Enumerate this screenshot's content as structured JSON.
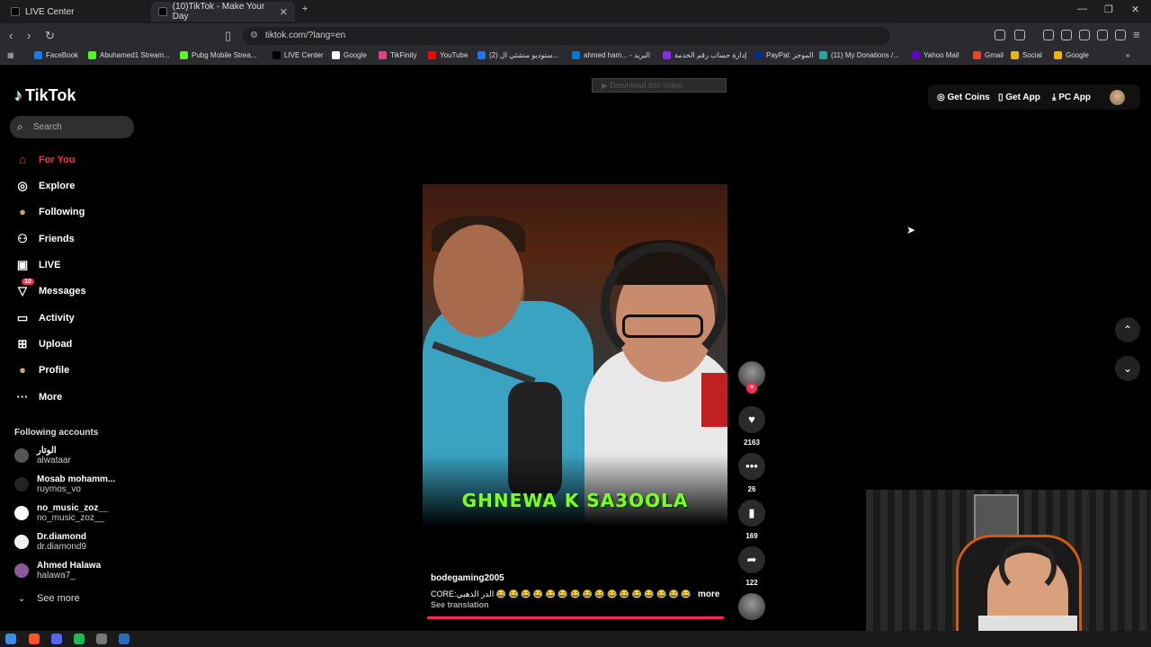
{
  "browser": {
    "tabs": [
      {
        "title": "LIVE Center"
      },
      {
        "title": "(10)TikTok - Make Your Day"
      }
    ],
    "url": "tiktok.com/?lang=en",
    "bookmarks": [
      {
        "label": "FaceBook",
        "color": "#1877f2"
      },
      {
        "label": "Abuhamed1 Stream...",
        "color": "#53fc18"
      },
      {
        "label": "Pubg Mobile Strea...",
        "color": "#53fc18"
      },
      {
        "label": "LIVE Center",
        "color": "#000000"
      },
      {
        "label": "Google",
        "color": "#ffffff"
      },
      {
        "label": "TikFinity",
        "color": "#e83e8c"
      },
      {
        "label": "YouTube",
        "color": "#ff0000"
      },
      {
        "label": "(2) ستوديو منشئي ال...",
        "color": "#1877f2"
      },
      {
        "label": "ahmed ham... - البريد",
        "color": "#0078d4"
      },
      {
        "label": "إدارة حساب رقم الخدمة",
        "color": "#8a2be2"
      },
      {
        "label": "PayPal: الموجز",
        "color": "#003087"
      },
      {
        "label": "(11) My Donations /...",
        "color": "#26a69a"
      },
      {
        "label": "Yahoo Mail",
        "color": "#6001d2"
      },
      {
        "label": "Gmail",
        "color": "#ea4335"
      },
      {
        "label": "Social",
        "color": "#e6b800"
      },
      {
        "label": "Google",
        "color": "#e6b800"
      }
    ]
  },
  "tiktok": {
    "logo": "TikTok",
    "search_placeholder": "Search",
    "nav": [
      {
        "label": "For You",
        "icon": "home-icon",
        "active": true
      },
      {
        "label": "Explore",
        "icon": "compass-icon"
      },
      {
        "label": "Following",
        "icon": "following-avatar-icon"
      },
      {
        "label": "Friends",
        "icon": "friends-icon"
      },
      {
        "label": "LIVE",
        "icon": "live-icon"
      },
      {
        "label": "Messages",
        "icon": "messages-icon",
        "badge": "10"
      },
      {
        "label": "Activity",
        "icon": "activity-icon"
      },
      {
        "label": "Upload",
        "icon": "upload-icon"
      },
      {
        "label": "Profile",
        "icon": "profile-avatar-icon"
      },
      {
        "label": "More",
        "icon": "more-dots-icon"
      }
    ],
    "following_header": "Following accounts",
    "following": [
      {
        "name": "الوتار",
        "handle": "alwataar",
        "color": "#555555"
      },
      {
        "name": "Mosab mohamm...",
        "handle": "ruymos_vo",
        "color": "#222222"
      },
      {
        "name": "no_music_zoz__",
        "handle": "no_music_zoz__",
        "color": "#ffffff"
      },
      {
        "name": "Dr.diamond",
        "handle": "dr.diamond9",
        "color": "#eeeeee"
      },
      {
        "name": "Ahmed Halawa",
        "handle": "halawa7_",
        "color": "#8a5a9a"
      }
    ],
    "see_more": "See more",
    "top_actions": {
      "coins": "Get Coins",
      "app": "Get App",
      "pc": "PC App"
    },
    "download_banner": "Download this video",
    "video": {
      "overlay_text": "GHNEWA K SA3OOLA",
      "author": "bodegaming2005",
      "description": "CORE:الدر الذهبي 😂 😂 😂 😂 😂 😂 😂 😂 😂 😂 😂 😂 😂 😂 😂 😂 ...",
      "more": "more",
      "translation": "See translation",
      "progress_percent": 100,
      "likes": "2163",
      "comments": "26",
      "saves": "169",
      "shares": "122"
    }
  }
}
